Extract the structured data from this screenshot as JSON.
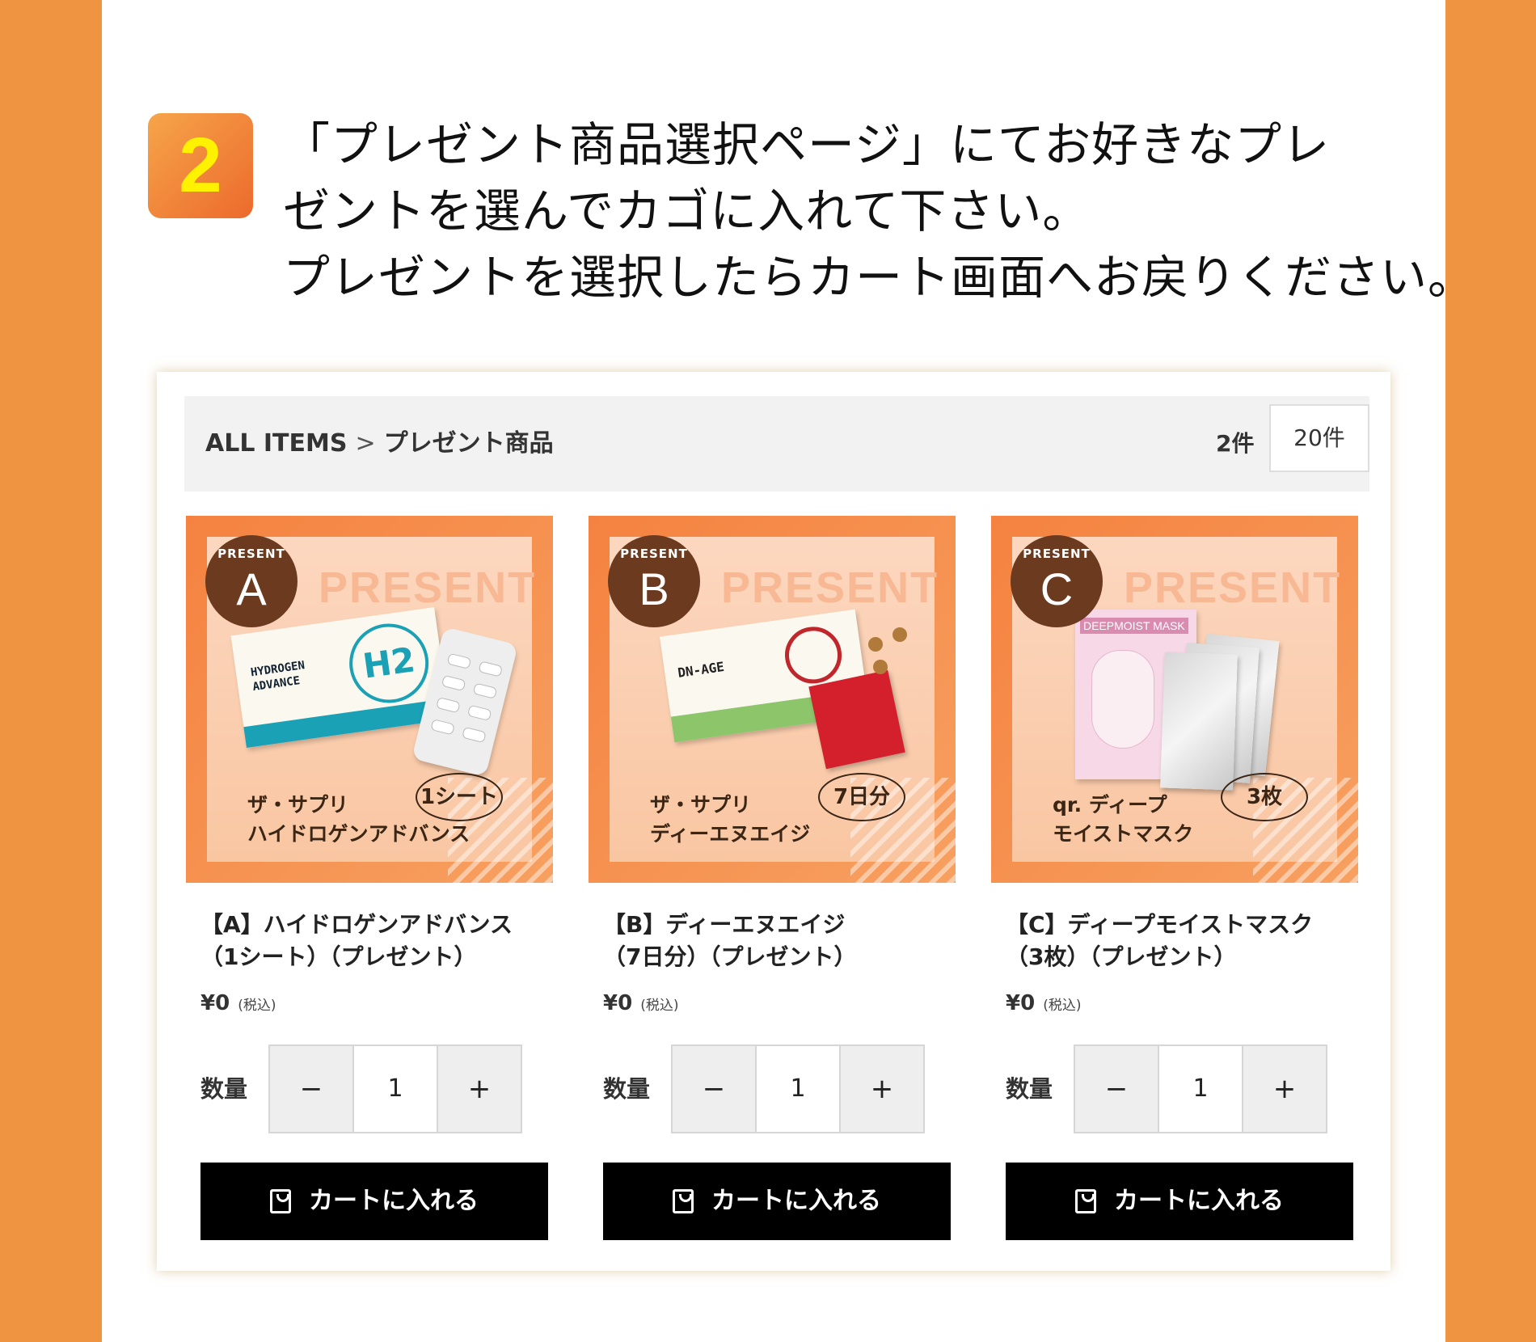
{
  "step_number": "2",
  "instruction_lines": [
    "「プレゼント商品選択ページ」にてお好きなプレ",
    "ゼントを選んでカゴに入れて下さい。",
    "プレゼントを選択したらカート画面へお戻りください。"
  ],
  "breadcrumb": {
    "root": "ALL ITEMS",
    "separator": ">",
    "current": "プレゼント商品"
  },
  "result_count": "2件",
  "per_page": "20件",
  "products": [
    {
      "badge_label": "PRESENT",
      "letter": "A",
      "banner_word": "PRESENT",
      "thumb_name_line1": "ザ・サプリ",
      "thumb_name_line2": "ハイドロゲンアドバンス",
      "thumb_qty": "1シート",
      "package_text_1": "HYDROGEN",
      "package_text_2": "ADVANCE",
      "package_logo": "H2",
      "title_line1": "【A】ハイドロゲンアドバンス",
      "title_line2": "（1シート）（プレゼント）",
      "price": "¥0",
      "tax": "(税込)",
      "qty_label": "数量",
      "minus": "−",
      "qty": "1",
      "plus": "+",
      "cart_label": "カートに入れる"
    },
    {
      "badge_label": "PRESENT",
      "letter": "B",
      "banner_word": "PRESENT",
      "thumb_name_line1": "ザ・サプリ",
      "thumb_name_line2": "ディーエヌエイジ",
      "thumb_qty": "7日分",
      "package_text_1": "DN-AGE",
      "title_line1": "【B】ディーエヌエイジ",
      "title_line2": "（7日分）（プレゼント）",
      "price": "¥0",
      "tax": "(税込)",
      "qty_label": "数量",
      "minus": "−",
      "qty": "1",
      "plus": "+",
      "cart_label": "カートに入れる"
    },
    {
      "badge_label": "PRESENT",
      "letter": "C",
      "banner_word": "PRESENT",
      "thumb_name_line1": "qr. ディープ",
      "thumb_name_line2": "モイストマスク",
      "thumb_qty": "3枚",
      "package_text_1": "DEEPMOIST MASK",
      "title_line1": "【C】ディープモイストマスク",
      "title_line2": "（3枚）（プレゼント）",
      "price": "¥0",
      "tax": "(税込)",
      "qty_label": "数量",
      "minus": "−",
      "qty": "1",
      "plus": "+",
      "cart_label": "カートに入れる"
    }
  ],
  "colors": {
    "page_background": "#ef9440",
    "badge_number": "#fff200",
    "letter_circle": "#6b3a1f",
    "cart_button": "#000000"
  }
}
